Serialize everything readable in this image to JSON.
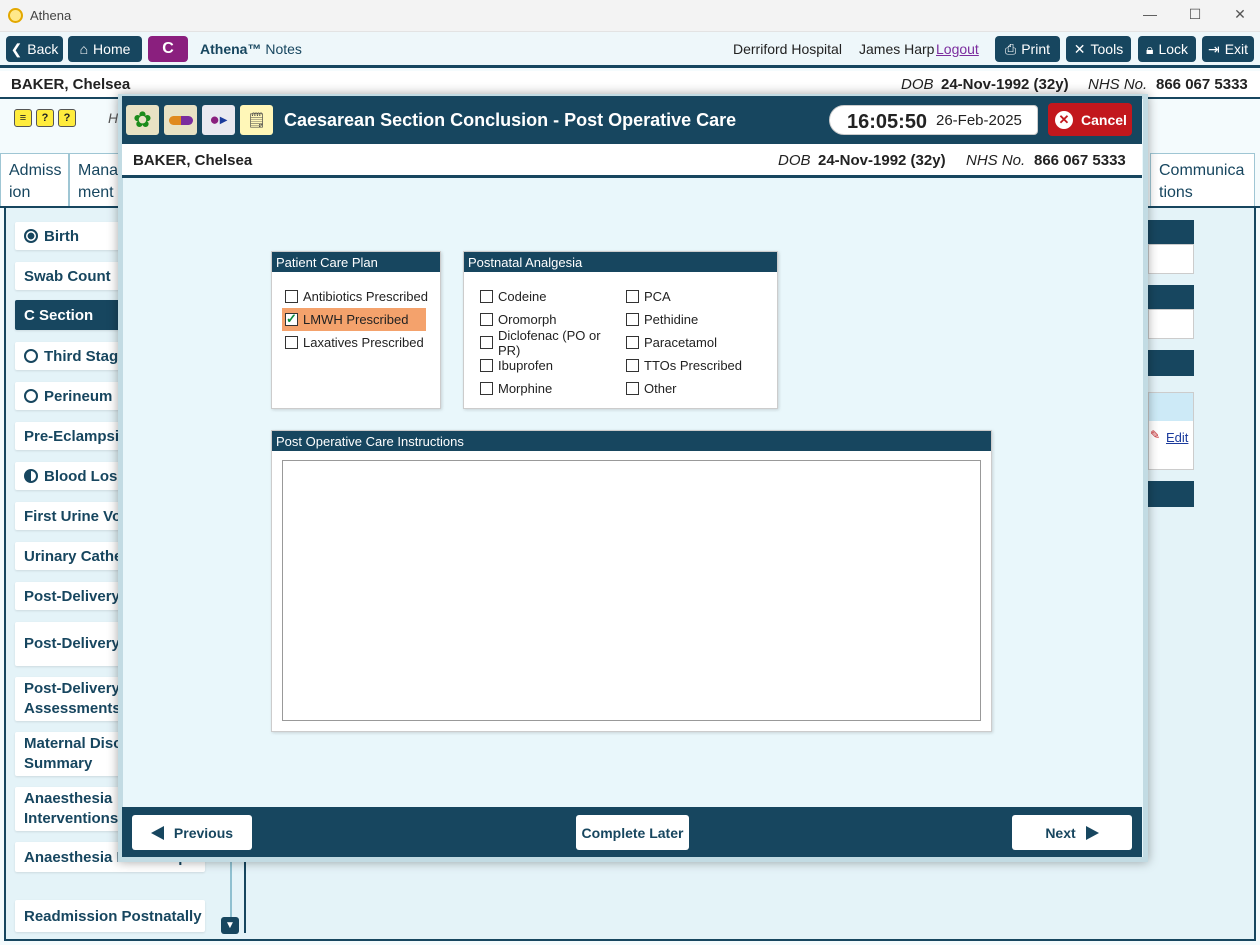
{
  "window": {
    "title": "Athena",
    "minimize": "—",
    "maximize": "☐",
    "close": "✕"
  },
  "toolbar": {
    "back": "Back",
    "home": "Home",
    "badge": "C",
    "app_name": "Athena™",
    "app_section": "Notes",
    "hospital": "Derriford Hospital",
    "user": "James Harp",
    "logout": "Logout",
    "print": "Print",
    "tools": "Tools",
    "lock": "Lock",
    "exit": "Exit"
  },
  "patient": {
    "name": "BAKER, Chelsea",
    "dob_label": "DOB",
    "dob": "24-Nov-1992 (32y)",
    "nhs_label": "NHS No.",
    "nhs": "866 067 5333"
  },
  "background": {
    "partial_letter": "H",
    "tabs": [
      {
        "line1": "Admiss",
        "line2": "ion"
      },
      {
        "line1": "Mana",
        "line2": "ment"
      },
      {
        "line1": "Communica",
        "line2": "tions"
      }
    ],
    "edit_link": "Edit",
    "sidebar": [
      {
        "label": "Birth",
        "marker": "full"
      },
      {
        "label": "Swab Count",
        "marker": "none"
      },
      {
        "label": "C Section",
        "marker": "none",
        "active": true
      },
      {
        "label": "Third Stage",
        "marker": "empty"
      },
      {
        "label": "Perineum",
        "marker": "empty"
      },
      {
        "label": "Pre-Eclampsia",
        "marker": "none"
      },
      {
        "label": "Blood Loss",
        "marker": "half"
      },
      {
        "label": "First Urine Void",
        "marker": "none"
      },
      {
        "label": "Urinary Catheter",
        "marker": "none"
      },
      {
        "label": "Post-Delivery",
        "marker": "none"
      },
      {
        "label": "Post-Delivery Notes",
        "marker": "none"
      },
      {
        "label": "Post-Delivery Assessments",
        "marker": "none"
      },
      {
        "label": "Maternal Discharge Summary",
        "marker": "none"
      },
      {
        "label": "Anaesthesia Interventions",
        "marker": "none"
      },
      {
        "label": "Anaesthesia Follow-up",
        "marker": "none"
      },
      {
        "label": "Readmission Postnatally",
        "marker": "none"
      }
    ]
  },
  "modal": {
    "title": "Caesarean Section Conclusion - Post Operative Care",
    "time": "16:05:50",
    "date": "26-Feb-2025",
    "cancel": "Cancel",
    "care_plan": {
      "heading": "Patient Care Plan",
      "items": [
        {
          "label": "Antibiotics Prescribed",
          "checked": false
        },
        {
          "label": "LMWH Prescribed",
          "checked": true
        },
        {
          "label": "Laxatives Prescribed",
          "checked": false
        }
      ]
    },
    "analgesia": {
      "heading": "Postnatal Analgesia",
      "col1": [
        {
          "label": "Codeine",
          "checked": false
        },
        {
          "label": "Oromorph",
          "checked": false
        },
        {
          "label": "Diclofenac (PO or PR)",
          "checked": false
        },
        {
          "label": "Ibuprofen",
          "checked": false
        },
        {
          "label": "Morphine",
          "checked": false
        }
      ],
      "col2": [
        {
          "label": "PCA",
          "checked": false
        },
        {
          "label": "Pethidine",
          "checked": false
        },
        {
          "label": "Paracetamol",
          "checked": false
        },
        {
          "label": "TTOs Prescribed",
          "checked": false
        },
        {
          "label": "Other",
          "checked": false
        }
      ]
    },
    "instructions": {
      "heading": "Post Operative Care Instructions",
      "value": ""
    },
    "footer": {
      "previous": "Previous",
      "complete_later": "Complete Later",
      "next": "Next"
    }
  },
  "colors": {
    "primary": "#17465f",
    "accent_purple": "#8a1f7e",
    "cancel_red": "#c2171d",
    "selected_orange": "#f4a26c"
  }
}
